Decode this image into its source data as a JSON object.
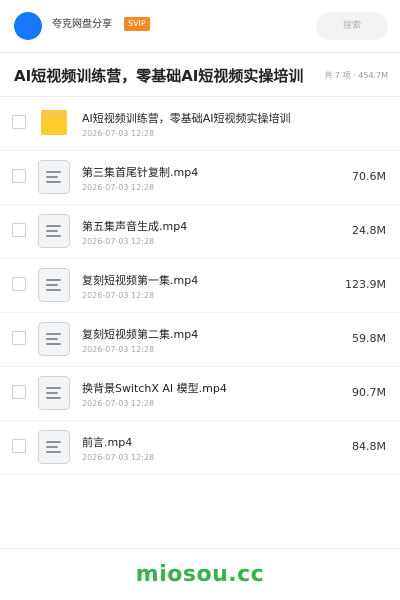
{
  "header": {
    "share_name": "夸克网盘分享",
    "badge": "SVIP",
    "search_placeholder": "搜索",
    "avatar_color": "#1677ff",
    "badge_color": "#f08a24"
  },
  "folder": {
    "title": "AI短视频训练营，零基础AI短视频实操培训",
    "meta": "共 7 项 · 454.7M"
  },
  "files": [
    {
      "name": "AI短视频训练营，零基础AI短视频实操培训",
      "date": "2026-07-03 12:28",
      "size": "",
      "type": "folder",
      "icon": "folder-icon"
    },
    {
      "name": "第三集首尾针复制.mp4",
      "date": "2026-07-03 12:28",
      "size": "70.6M",
      "type": "file",
      "icon": "document-icon"
    },
    {
      "name": "第五集声音生成.mp4",
      "date": "2026-07-03 12:28",
      "size": "24.8M",
      "type": "file",
      "icon": "document-icon"
    },
    {
      "name": "复刻短视频第一集.mp4",
      "date": "2026-07-03 12:28",
      "size": "123.9M",
      "type": "file",
      "icon": "document-icon"
    },
    {
      "name": "复刻短视频第二集.mp4",
      "date": "2026-07-03 12:28",
      "size": "59.8M",
      "type": "file",
      "icon": "document-icon"
    },
    {
      "name": "换背景SwitchX AI 模型.mp4",
      "date": "2026-07-03 12:28",
      "size": "90.7M",
      "type": "file",
      "icon": "document-icon"
    },
    {
      "name": "前言.mp4",
      "date": "2026-07-03 12:28",
      "size": "84.8M",
      "type": "file",
      "icon": "document-icon"
    }
  ],
  "footer": {
    "watermark": "miosou.cc",
    "watermark_color": "#36b34a"
  }
}
